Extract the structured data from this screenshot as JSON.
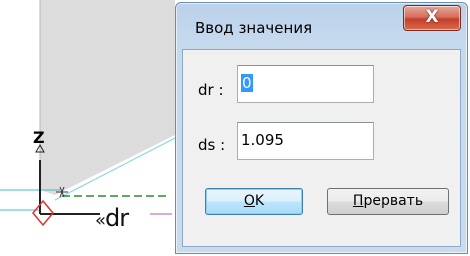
{
  "viewport": {
    "axis_z_label": "Z",
    "axis_x_label": "dr",
    "axis_prefix_glyph": "«"
  },
  "dialog": {
    "title": "Ввод значения",
    "close_glyph": "X",
    "fields": [
      {
        "label": "dr :",
        "value": "0"
      },
      {
        "label": "ds :",
        "value": "1.095"
      }
    ],
    "buttons": {
      "ok_mnemonic": "O",
      "ok_rest": "K",
      "cancel_mnemonic": "П",
      "cancel_rest": "рервать"
    }
  },
  "colors": {
    "selection": "#3399ff",
    "close_button": "#c4402a",
    "axis_green": "#2e8b2e",
    "axis_cyan": "#44b8c8",
    "marker_red": "#e03030"
  }
}
